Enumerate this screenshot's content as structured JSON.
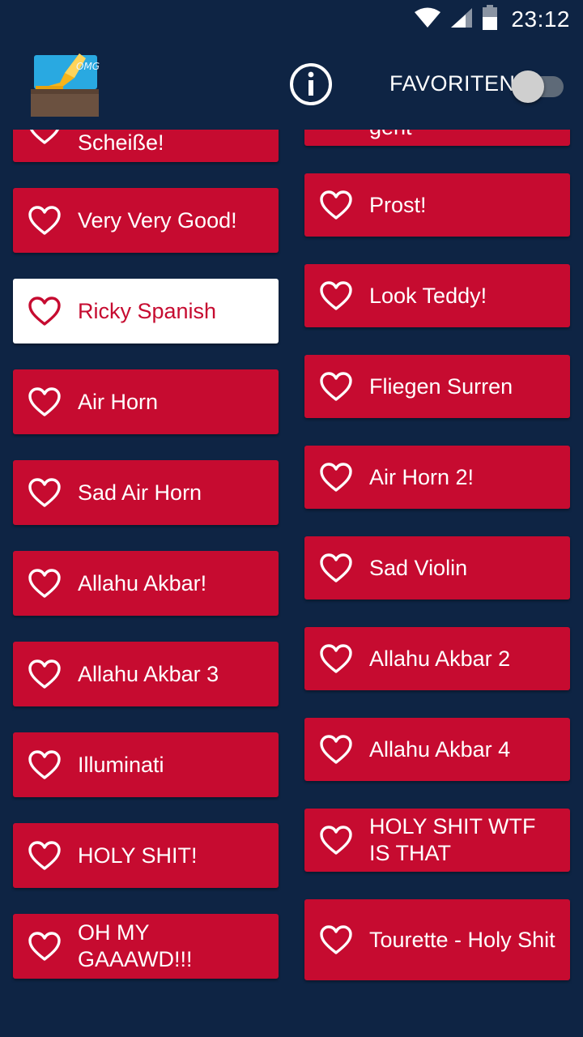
{
  "status_bar": {
    "time": "23:12",
    "icons": [
      "wifi-icon",
      "signal-icon",
      "battery-icon"
    ]
  },
  "toolbar": {
    "logo_icon": "gramophone-omg-logo",
    "logo_text": "OMG",
    "info_icon": "info-icon",
    "favorites_label": "FAVORITEN",
    "favorites_enabled": false
  },
  "colors": {
    "background": "#0e2444",
    "card": "#c60b30",
    "card_selected": "#ffffff",
    "text_on_card": "#ffffff"
  },
  "sounds": {
    "left": [
      {
        "label": "Spaxx mal fest die Scheiße!",
        "favorite": false,
        "selected": false
      },
      {
        "label": "Very Very Good!",
        "favorite": false,
        "selected": false
      },
      {
        "label": "Ricky Spanish",
        "favorite": false,
        "selected": true
      },
      {
        "label": "Air Horn",
        "favorite": false,
        "selected": false
      },
      {
        "label": "Sad Air Horn",
        "favorite": false,
        "selected": false
      },
      {
        "label": "Allahu Akbar!",
        "favorite": false,
        "selected": false
      },
      {
        "label": "Allahu Akbar 3",
        "favorite": false,
        "selected": false
      },
      {
        "label": "Illuminati",
        "favorite": false,
        "selected": false
      },
      {
        "label": "HOLY SHIT!",
        "favorite": false,
        "selected": false
      },
      {
        "label": "OH MY GAAAWD!!!",
        "favorite": false,
        "selected": false
      }
    ],
    "right": [
      {
        "label": "Wenn dus mal gut geht",
        "favorite": false,
        "selected": false
      },
      {
        "label": "Prost!",
        "favorite": false,
        "selected": false
      },
      {
        "label": "Look Teddy!",
        "favorite": false,
        "selected": false
      },
      {
        "label": "Fliegen Surren",
        "favorite": false,
        "selected": false
      },
      {
        "label": "Air Horn 2!",
        "favorite": false,
        "selected": false
      },
      {
        "label": "Sad Violin",
        "favorite": false,
        "selected": false
      },
      {
        "label": "Allahu Akbar 2",
        "favorite": false,
        "selected": false
      },
      {
        "label": "Allahu Akbar 4",
        "favorite": false,
        "selected": false
      },
      {
        "label": "HOLY SHIT WTF IS THAT",
        "favorite": false,
        "selected": false
      },
      {
        "label": "Tourette - Holy Shit",
        "favorite": false,
        "selected": false
      }
    ]
  }
}
